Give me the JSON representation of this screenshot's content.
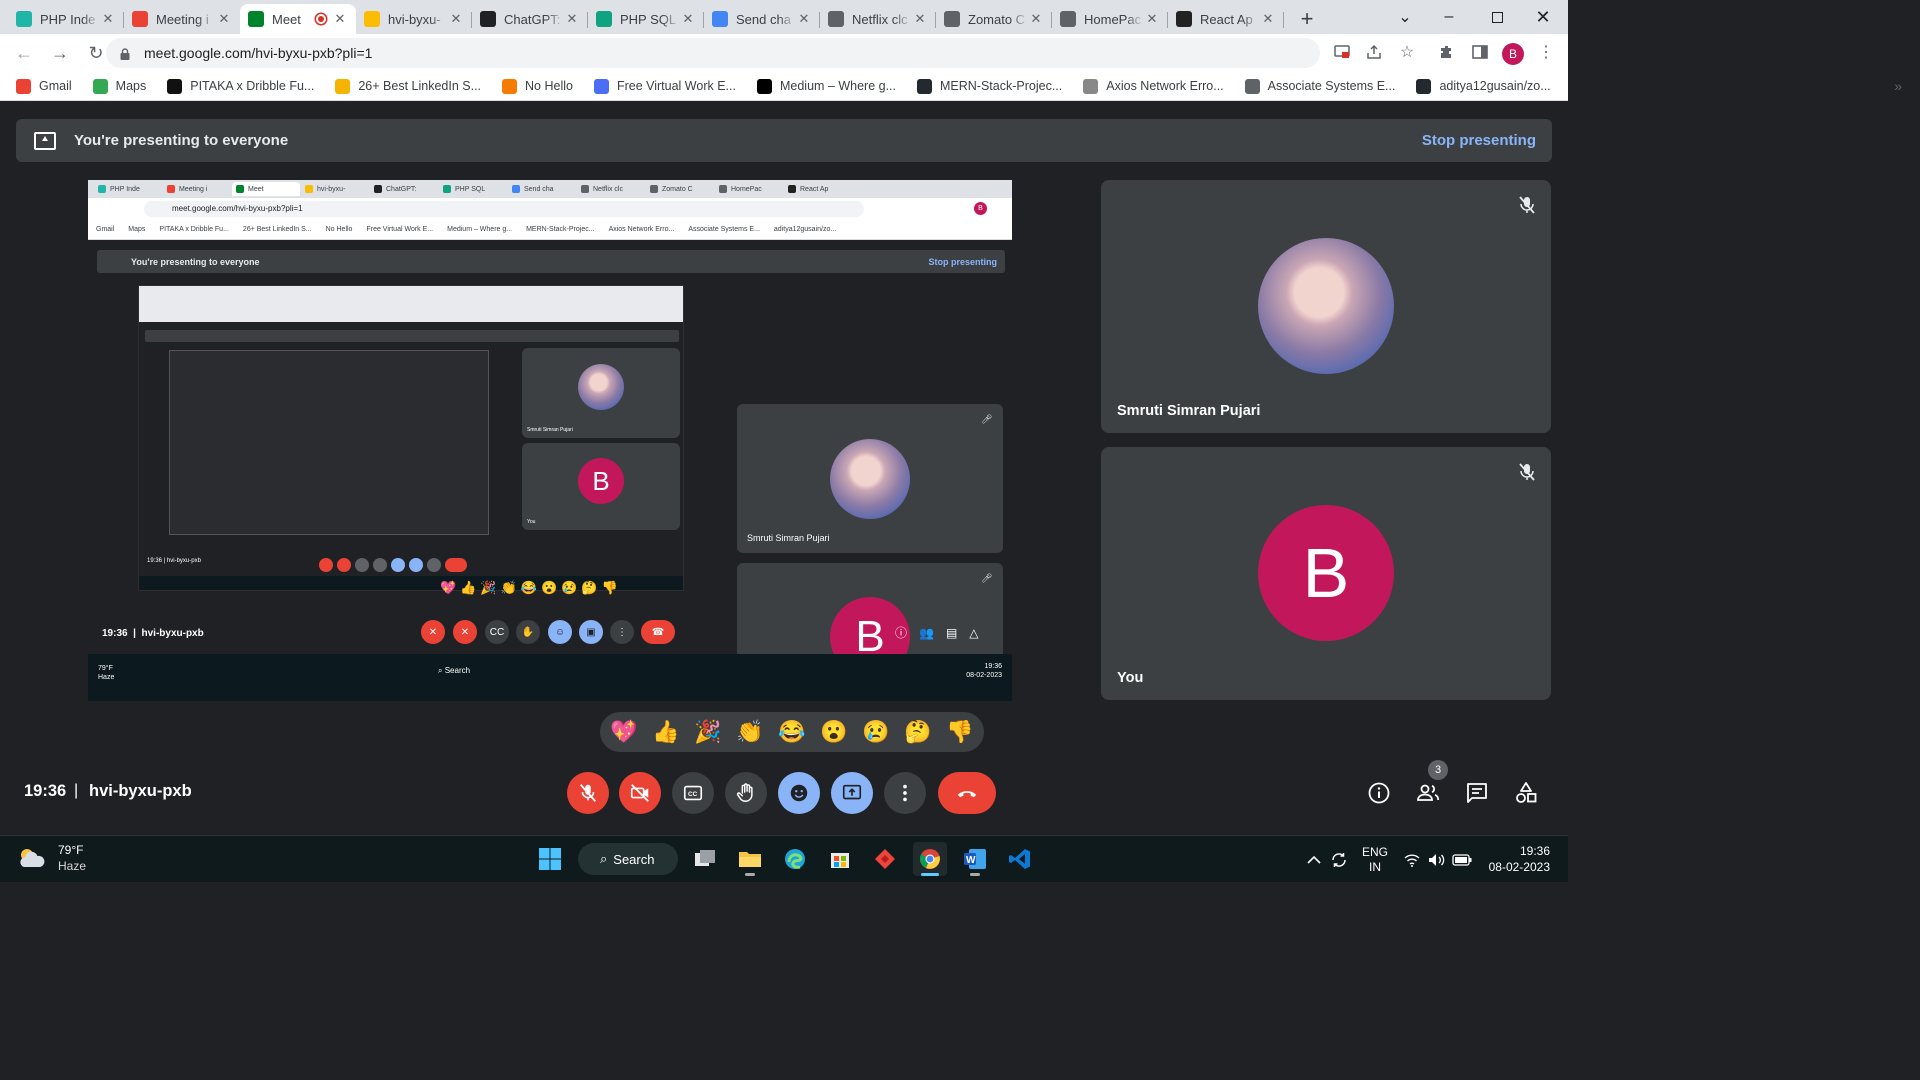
{
  "browser": {
    "tabs": [
      {
        "label": "PHP Inde",
        "icon": "phpind-icon",
        "color": "#1fb6a8"
      },
      {
        "label": "Meeting i",
        "icon": "gmail-icon",
        "color": "#ea4335"
      },
      {
        "label": "Meet",
        "icon": "meet-icon",
        "color": "#00832d",
        "active": true
      },
      {
        "label": "hvi-byxu-",
        "icon": "keep-icon",
        "color": "#fbbc04"
      },
      {
        "label": "ChatGPT:",
        "icon": "chatgpt-icon",
        "color": "#202124"
      },
      {
        "label": "PHP SQL",
        "icon": "chatgpt-icon",
        "color": "#10a37f"
      },
      {
        "label": "Send cha",
        "icon": "google-icon",
        "color": "#4285f4"
      },
      {
        "label": "Netflix clc",
        "icon": "globe-icon",
        "color": "#5f6368"
      },
      {
        "label": "Zomato C",
        "icon": "globe-icon",
        "color": "#5f6368"
      },
      {
        "label": "HomePac",
        "icon": "globe-icon",
        "color": "#5f6368"
      },
      {
        "label": "React Ap",
        "icon": "react-icon",
        "color": "#222"
      }
    ],
    "url": "meet.google.com/hvi-byxu-pxb?pli=1",
    "profile_initial": "B",
    "bookmarks": [
      {
        "label": "Gmail",
        "icon": "gmail-icon",
        "color": "#ea4335"
      },
      {
        "label": "Maps",
        "icon": "maps-icon",
        "color": "#34a853"
      },
      {
        "label": "PITAKA x Dribble Fu...",
        "icon": "pitaka-icon",
        "color": "#111"
      },
      {
        "label": "26+ Best LinkedIn S...",
        "icon": "bookmark-icon",
        "color": "#f5b400"
      },
      {
        "label": "No Hello",
        "icon": "nohello-icon",
        "color": "#f57c00"
      },
      {
        "label": "Free Virtual Work E...",
        "icon": "forage-icon",
        "color": "#4c6ef5"
      },
      {
        "label": "Medium – Where g...",
        "icon": "medium-icon",
        "color": "#000"
      },
      {
        "label": "MERN-Stack-Projec...",
        "icon": "github-icon",
        "color": "#24292f"
      },
      {
        "label": "Axios Network Erro...",
        "icon": "axios-icon",
        "color": "#888"
      },
      {
        "label": "Associate Systems E...",
        "icon": "globe-icon",
        "color": "#5f6368"
      },
      {
        "label": "aditya12gusain/zo...",
        "icon": "github-icon",
        "color": "#24292f"
      }
    ]
  },
  "meet": {
    "presenting_text": "You're presenting to everyone",
    "stop_presenting": "Stop presenting",
    "participants": [
      {
        "name": "Smruti Simran Pujari",
        "initial": ""
      },
      {
        "name": "You",
        "initial": "B"
      }
    ],
    "reactions": [
      "💖",
      "👍",
      "🎉",
      "👏",
      "😂",
      "😮",
      "😢",
      "🤔",
      "👎"
    ],
    "time": "19:36",
    "separator": "|",
    "meeting_code": "hvi-byxu-pxb",
    "people_count": "3",
    "colors": {
      "hangup": "#ea4335",
      "active": "#8ab4f8",
      "avatar": "#c2185b",
      "control_bg": "#3c4043"
    }
  },
  "taskbar": {
    "temperature": "79°F",
    "condition": "Haze",
    "search_label": "Search",
    "language": "ENG",
    "region": "IN",
    "time": "19:36",
    "date": "08-02-2023"
  }
}
